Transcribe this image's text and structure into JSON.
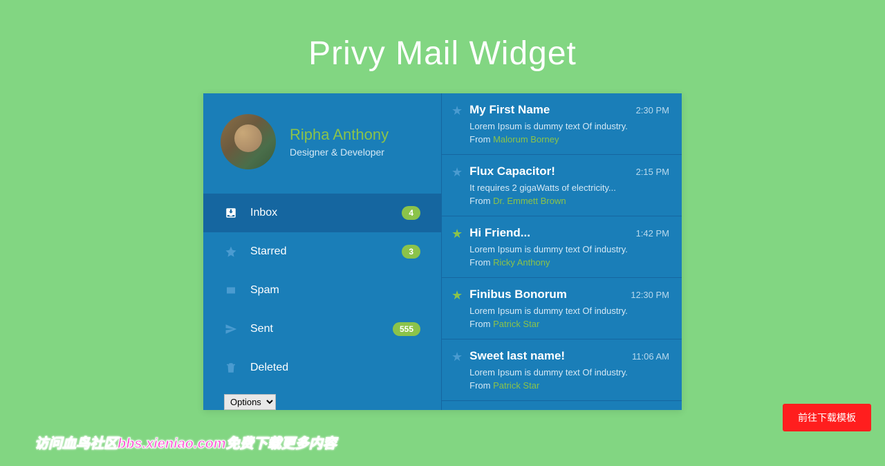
{
  "title": "Privy Mail Widget",
  "profile": {
    "name": "Ripha Anthony",
    "role": "Designer & Developer"
  },
  "nav": [
    {
      "icon": "inbox",
      "label": "Inbox",
      "badge": "4",
      "active": true
    },
    {
      "icon": "star",
      "label": "Starred",
      "badge": "3",
      "active": false
    },
    {
      "icon": "spam",
      "label": "Spam",
      "badge": "",
      "active": false
    },
    {
      "icon": "sent",
      "label": "Sent",
      "badge": "555",
      "active": false
    },
    {
      "icon": "trash",
      "label": "Deleted",
      "badge": "",
      "active": false
    }
  ],
  "options_label": "Options",
  "from_prefix": "From ",
  "messages": [
    {
      "starred": false,
      "subject": "My First Name",
      "time": "2:30 PM",
      "preview": "Lorem Ipsum is dummy text Of industry.",
      "sender": "Malorum Borney"
    },
    {
      "starred": false,
      "subject": "Flux Capacitor!",
      "time": "2:15 PM",
      "preview": "It requires 2 gigaWatts of electricity...",
      "sender": "Dr. Emmett Brown"
    },
    {
      "starred": true,
      "subject": "Hi Friend...",
      "time": "1:42 PM",
      "preview": "Lorem Ipsum is dummy text Of industry.",
      "sender": "Ricky Anthony"
    },
    {
      "starred": true,
      "subject": "Finibus Bonorum",
      "time": "12:30 PM",
      "preview": "Lorem Ipsum is dummy text Of industry.",
      "sender": "Patrick Star"
    },
    {
      "starred": false,
      "subject": "Sweet last name!",
      "time": "11:06 AM",
      "preview": "Lorem Ipsum is dummy text Of industry.",
      "sender": "Patrick Star"
    }
  ],
  "download_button": "前往下载模板",
  "watermark": "访问血鸟社区bbs.xieniao.com免费下载更多内容"
}
